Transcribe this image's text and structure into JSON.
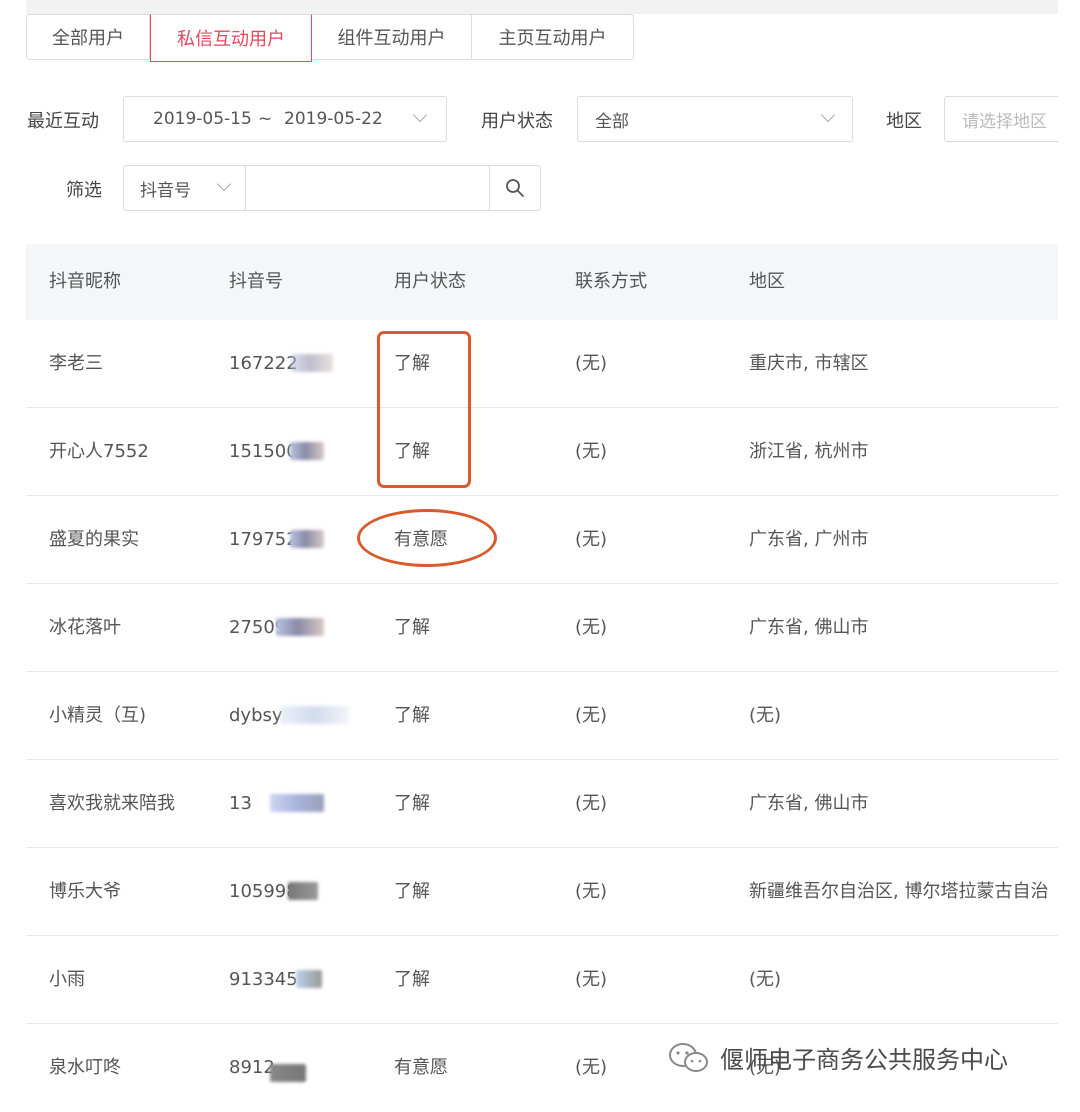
{
  "tabs": [
    "全部用户",
    "私信互动用户",
    "组件互动用户",
    "主页互动用户"
  ],
  "filters": {
    "recent_label": "最近互动",
    "date_start": "2019-05-15",
    "date_sep": "~",
    "date_end": "2019-05-22",
    "status_label": "用户状态",
    "status_value": "全部",
    "region_label": "地区",
    "region_placeholder": "请选择地区",
    "filter_label": "筛选",
    "filter_type": "抖音号"
  },
  "table": {
    "headers": [
      "抖音昵称",
      "抖音号",
      "用户状态",
      "联系方式",
      "地区"
    ],
    "rows": [
      {
        "nickname": "李老三",
        "douyin_id": "167222",
        "status": "了解",
        "contact": "(无)",
        "region": "重庆市, 市辖区"
      },
      {
        "nickname": "开心人7552",
        "douyin_id": "151500",
        "status": "了解",
        "contact": "(无)",
        "region": "浙江省, 杭州市"
      },
      {
        "nickname": "盛夏的果实",
        "douyin_id": "179752",
        "status": "有意愿",
        "contact": "(无)",
        "region": "广东省, 广州市"
      },
      {
        "nickname": "冰花落叶",
        "douyin_id": "27509",
        "status": "了解",
        "contact": "(无)",
        "region": "广东省, 佛山市"
      },
      {
        "nickname": "小精灵（互)",
        "douyin_id": "dybsy",
        "status": "了解",
        "contact": "(无)",
        "region": "(无)"
      },
      {
        "nickname": "喜欢我就来陪我",
        "douyin_id": "13",
        "status": "了解",
        "contact": "(无)",
        "region": "广东省, 佛山市"
      },
      {
        "nickname": "博乐大爷",
        "douyin_id": "105998",
        "status": "了解",
        "contact": "(无)",
        "region": "新疆维吾尔自治区, 博尔塔拉蒙古自治"
      },
      {
        "nickname": "小雨",
        "douyin_id": "913345",
        "status": "了解",
        "contact": "(无)",
        "region": "(无)"
      },
      {
        "nickname": "泉水叮咚",
        "douyin_id": "8912",
        "status": "有意愿",
        "contact": "(无)",
        "region": "(无)"
      }
    ]
  },
  "watermark": "偃师电子商务公共服务中心",
  "colors": {
    "active_tab": "#e8455e",
    "annotation": "#d85a2d",
    "header_bg": "#f5f6f8"
  }
}
